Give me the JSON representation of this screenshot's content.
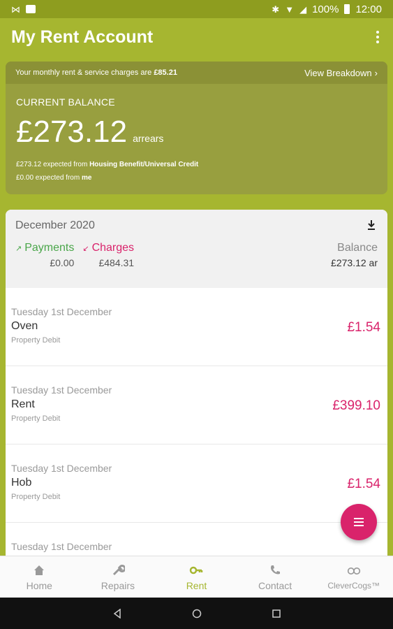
{
  "status_bar": {
    "battery": "100%",
    "time": "12:00"
  },
  "app_bar": {
    "title": "My Rent Account"
  },
  "summary": {
    "monthly_text_prefix": "Your monthly rent & service charges are ",
    "monthly_amount": "£85.21",
    "view_breakdown": "View Breakdown",
    "current_balance_label": "CURRENT BALANCE",
    "current_balance": "£273.12",
    "balance_status": "arrears",
    "expected_hb_amount": "£273.12 expected from ",
    "expected_hb_source": "Housing Benefit/Universal Credit",
    "expected_me_amount": "£0.00 expected from ",
    "expected_me_source": "me"
  },
  "statement": {
    "month": "December 2020",
    "payments_label": "Payments",
    "payments_value": "£0.00",
    "charges_label": "Charges",
    "charges_value": "£484.31",
    "balance_label": "Balance",
    "balance_value": "£273.12 ar",
    "transactions": [
      {
        "date": "Tuesday 1st December",
        "name": "Oven",
        "type": "Property Debit",
        "amount": "£1.54"
      },
      {
        "date": "Tuesday 1st December",
        "name": "Rent",
        "type": "Property Debit",
        "amount": "£399.10"
      },
      {
        "date": "Tuesday 1st December",
        "name": "Hob",
        "type": "Property Debit",
        "amount": "£1.54"
      },
      {
        "date": "Tuesday 1st December",
        "name": "",
        "type": "",
        "amount": ""
      }
    ]
  },
  "bottom_nav": {
    "items": [
      {
        "label": "Home",
        "icon": "home-icon"
      },
      {
        "label": "Repairs",
        "icon": "wrench-icon"
      },
      {
        "label": "Rent",
        "icon": "key-icon"
      },
      {
        "label": "Contact",
        "icon": "phone-icon"
      },
      {
        "label": "CleverCogs™",
        "icon": "clevercogs-icon"
      }
    ],
    "active": "Rent"
  },
  "colors": {
    "brand": "#a6b630",
    "accent": "#d9236b",
    "payments": "#4aa64a"
  }
}
